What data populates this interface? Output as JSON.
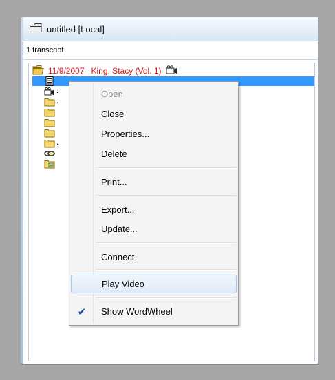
{
  "window": {
    "title": "untitled [Local]",
    "transcript_count": "1 transcript"
  },
  "tree": {
    "root": {
      "date": "11/9/2007",
      "witness": "King, Stacy  (Vol. 1)",
      "color": "#d11111",
      "icons": [
        "open-folder-icon",
        "video-camera-icon"
      ]
    },
    "selected_row_color": "#3399ff",
    "child_icons": [
      "document-icon",
      "video-camera-icon",
      "folder-icon",
      "folder-icon",
      "folder-icon",
      "folder-icon",
      "folder-icon",
      "link-icon",
      "card-folder-icon"
    ],
    "row_suffix": "."
  },
  "context_menu": {
    "items": [
      {
        "label": "Open",
        "enabled": false
      },
      {
        "label": "Close",
        "enabled": true
      },
      {
        "label": "Properties...",
        "enabled": true
      },
      {
        "label": "Delete",
        "enabled": true
      },
      {
        "label": "Print...",
        "enabled": true
      },
      {
        "label": "Export...",
        "enabled": true
      },
      {
        "label": "Update...",
        "enabled": true
      },
      {
        "label": "Connect",
        "enabled": true
      },
      {
        "label": "Play Video",
        "enabled": true,
        "highlighted": true
      },
      {
        "label": "Show WordWheel",
        "enabled": true,
        "checked": true
      }
    ]
  }
}
